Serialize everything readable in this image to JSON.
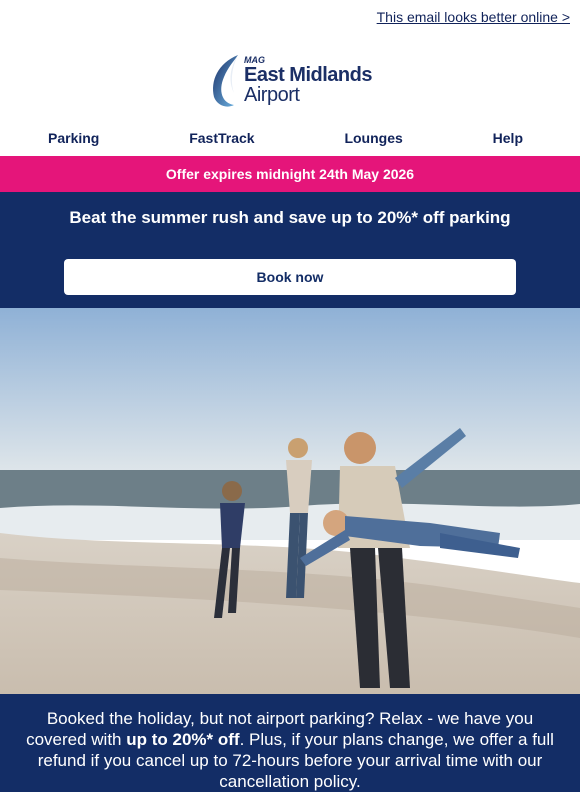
{
  "header": {
    "online_link": "This email looks better online >"
  },
  "logo": {
    "mag": "MAG",
    "line1": "East Midlands",
    "line2": "Airport"
  },
  "nav": {
    "items": [
      "Parking",
      "FastTrack",
      "Lounges",
      "Help"
    ]
  },
  "offer": {
    "text": "Offer expires midnight 24th May 2026"
  },
  "hero": {
    "title": "Beat the summer rush and save up to 20%* off parking",
    "button": "Book now"
  },
  "body": {
    "text_before": "Booked the holiday, but not airport parking? Relax - we have you covered with ",
    "bold": "up to 20%* off",
    "text_after": ". Plus, if your plans change, we offer a full refund if you cancel up to 72-hours before your arrival time with our cancellation policy."
  },
  "colors": {
    "navy": "#132d66",
    "pink": "#e5157a"
  }
}
